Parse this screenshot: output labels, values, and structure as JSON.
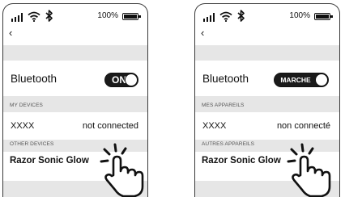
{
  "screens": [
    {
      "status_bar": {
        "battery_percent": "100%"
      },
      "back_glyph": "‹",
      "bluetooth_label": "Bluetooth",
      "toggle_label": "ON",
      "toggle_state": "on",
      "my_devices_header": "MY DEVICES",
      "device_name": "XXXX",
      "device_status": "not connected",
      "other_devices_header": "OTHER DEVICES",
      "other_device_name": "Razor Sonic Glow"
    },
    {
      "status_bar": {
        "battery_percent": "100%"
      },
      "back_glyph": "‹",
      "bluetooth_label": "Bluetooth",
      "toggle_label": "MARCHE",
      "toggle_state": "on",
      "my_devices_header": "MES APPAREILS",
      "device_name": "XXXX",
      "device_status": "non connecté",
      "other_devices_header": "AUTRES APPAREILS",
      "other_device_name": "Razor Sonic Glow"
    }
  ],
  "icons": [
    "signal-icon",
    "wifi-icon",
    "bluetooth-icon",
    "battery-icon",
    "back-icon",
    "tap-hand-icon"
  ],
  "colors": {
    "section_background": "#e6e6e6",
    "toggle_on": "#1a1a1a",
    "text": "#111111"
  }
}
